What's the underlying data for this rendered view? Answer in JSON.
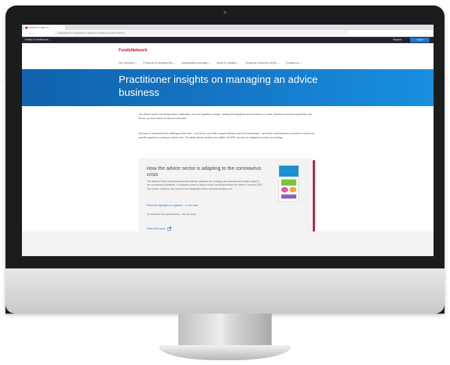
{
  "browser": {
    "tab_title": "Practitioner insights on...",
    "address": "fundsnetwork.co.uk/practitioner-insights-on-managing-an-advice-business",
    "nav_glyphs": "‹ › ↻ ⌂",
    "toolbar_glyphs": "☆ ⋮"
  },
  "site_top": {
    "site_name": "Fidelity FundsNetwork ⌄",
    "register": "Register",
    "login": "Log in"
  },
  "header": {
    "logo": "FundsNetwork",
    "nav": [
      {
        "label": "Our services ⌄"
      },
      {
        "label": "Products & investments ⌄"
      },
      {
        "label": "Sustainable investing ⌄"
      },
      {
        "label": "News & insights ⌄"
      },
      {
        "label": "Technical resource centre ⌄"
      },
      {
        "label": "Contact us ⌄"
      }
    ]
  },
  "hero": {
    "title": "Practitioner insights on managing an advice business"
  },
  "intro": {
    "p1": "The advice sector has always faced challenges, such as regulatory change, shifting demographics and pressures on costs. Now the coronavirus pandemic has thrown up fresh issues for firms to deal with.",
    "p2": "We want to understand the challenges firms face – so that we can better support advisers and their businesses – and have commissioned a number of reports on specific aspects of running an advice firm. Our latest adviser studies are entitled 'IN-ONE' and we are delighted to share our findings."
  },
  "card": {
    "title": "How the advice sector is adapting to the coronavirus crisis",
    "body": "The Adviser Firms study assesses how adviser attitudes are changing as business and society adapt to the coronavirus pandemic. It compares views in May to those conducted before the crisis in January 2020. The results reinforce how resilient and adaptable today's financial advisers are.",
    "link_highlights": "Read the highlights at a glance – 2 min read",
    "line_full": "Or read the full report below – 15 min read",
    "link_full": "Read full report"
  },
  "icons": {
    "external": "external-link-icon",
    "camera": "camera-icon"
  },
  "colors": {
    "brand_red": "#c8102e",
    "hero_blue": "#1678c8",
    "link_blue": "#1b6fc2",
    "login_blue": "#1b78d0"
  }
}
